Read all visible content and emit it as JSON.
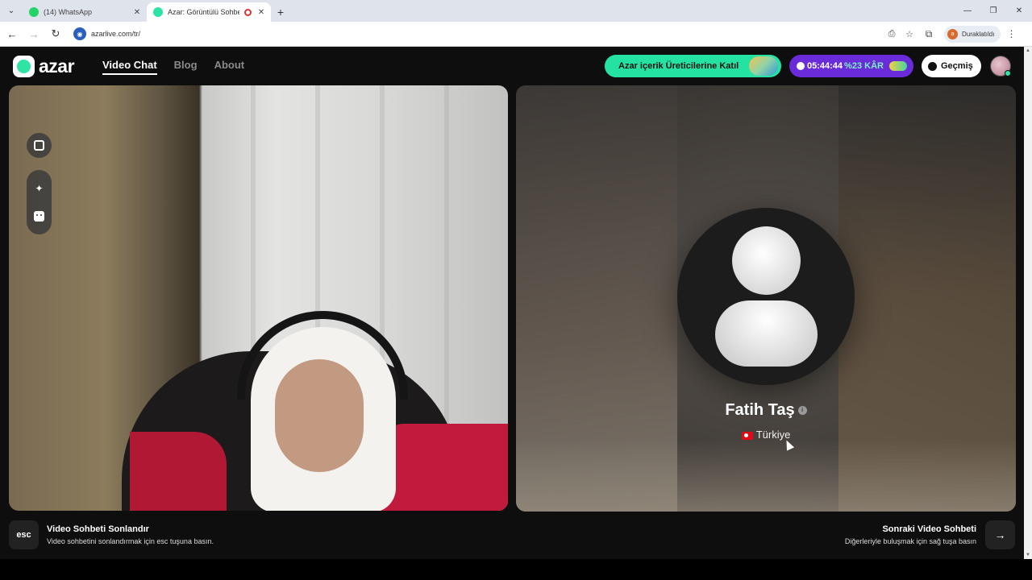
{
  "browser": {
    "tabs": [
      {
        "title": "(14) WhatsApp",
        "favicon_color": "#25d366"
      },
      {
        "title": "Azar: Görüntülü Sohbet & Y",
        "favicon_color": "#2ee3a4"
      }
    ],
    "url": "azarlive.com/tr/",
    "profile_status": "Duraklatıldı",
    "profile_initial": "a"
  },
  "header": {
    "logo_text": "azar",
    "nav": [
      {
        "label": "Video Chat",
        "active": true
      },
      {
        "label": "Blog",
        "active": false
      },
      {
        "label": "About",
        "active": false
      }
    ],
    "creator_label": "Azar içerik Üreticilerine Katıl",
    "timer": "05:44:44",
    "timer_offer": "%23 KÂR",
    "history_label": "Geçmiş"
  },
  "peer": {
    "name": "Fatih Taş",
    "country": "Türkiye"
  },
  "footer": {
    "esc_key": "esc",
    "end_title": "Video Sohbeti Sonlandır",
    "end_sub": "Video sohbetini sonlandırmak için esc tuşuna basın.",
    "next_title": "Sonraki Video Sohbeti",
    "next_sub": "Diğerleriyle buluşmak için sağ tuşa basın"
  },
  "colors": {
    "brand": "#2ee3a4",
    "timer_bg": "#6a2bd9",
    "background": "#0e0e0e"
  }
}
